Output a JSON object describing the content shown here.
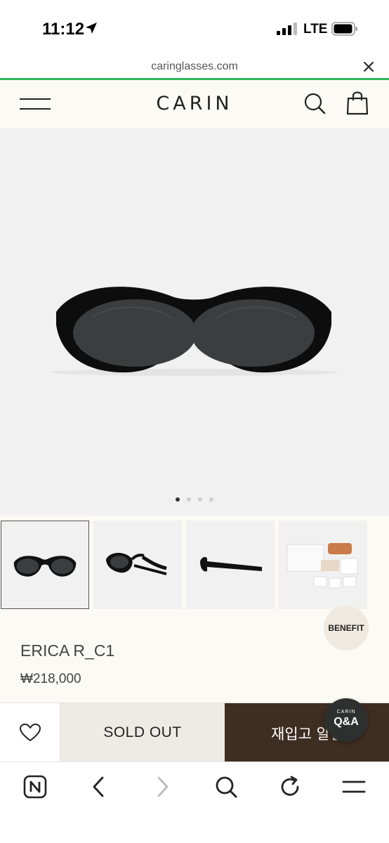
{
  "status_bar": {
    "time": "11:12",
    "network": "LTE"
  },
  "browser": {
    "url": "caringlasses.com"
  },
  "header": {
    "brand": "CARIN"
  },
  "gallery": {
    "slide_count": 4,
    "active_slide": 1
  },
  "product": {
    "name": "ERICA R_C1",
    "price": "₩218,000"
  },
  "badges": {
    "benefit": "BENEFIT"
  },
  "actions": {
    "sold_out_label": "SOLD OUT",
    "restock_label": "재입고 알림"
  },
  "qa_button": {
    "brand_small": "CARIN",
    "label": "Q&A"
  },
  "colors": {
    "header_bg": "#fcfaf4",
    "hero_bg": "#f1f1f1",
    "progress_green": "#2fb85c",
    "restock_bg": "#3e2d21",
    "sold_out_bg": "#eeebe4"
  },
  "icons": {
    "status": [
      "location-arrow-icon",
      "signal-icon",
      "battery-icon"
    ],
    "header": [
      "menu-icon",
      "search-icon",
      "shopping-bag-icon"
    ],
    "toolbar": [
      "naver-home-icon",
      "back-icon",
      "forward-icon",
      "search-icon",
      "refresh-icon",
      "menu-icon"
    ]
  }
}
